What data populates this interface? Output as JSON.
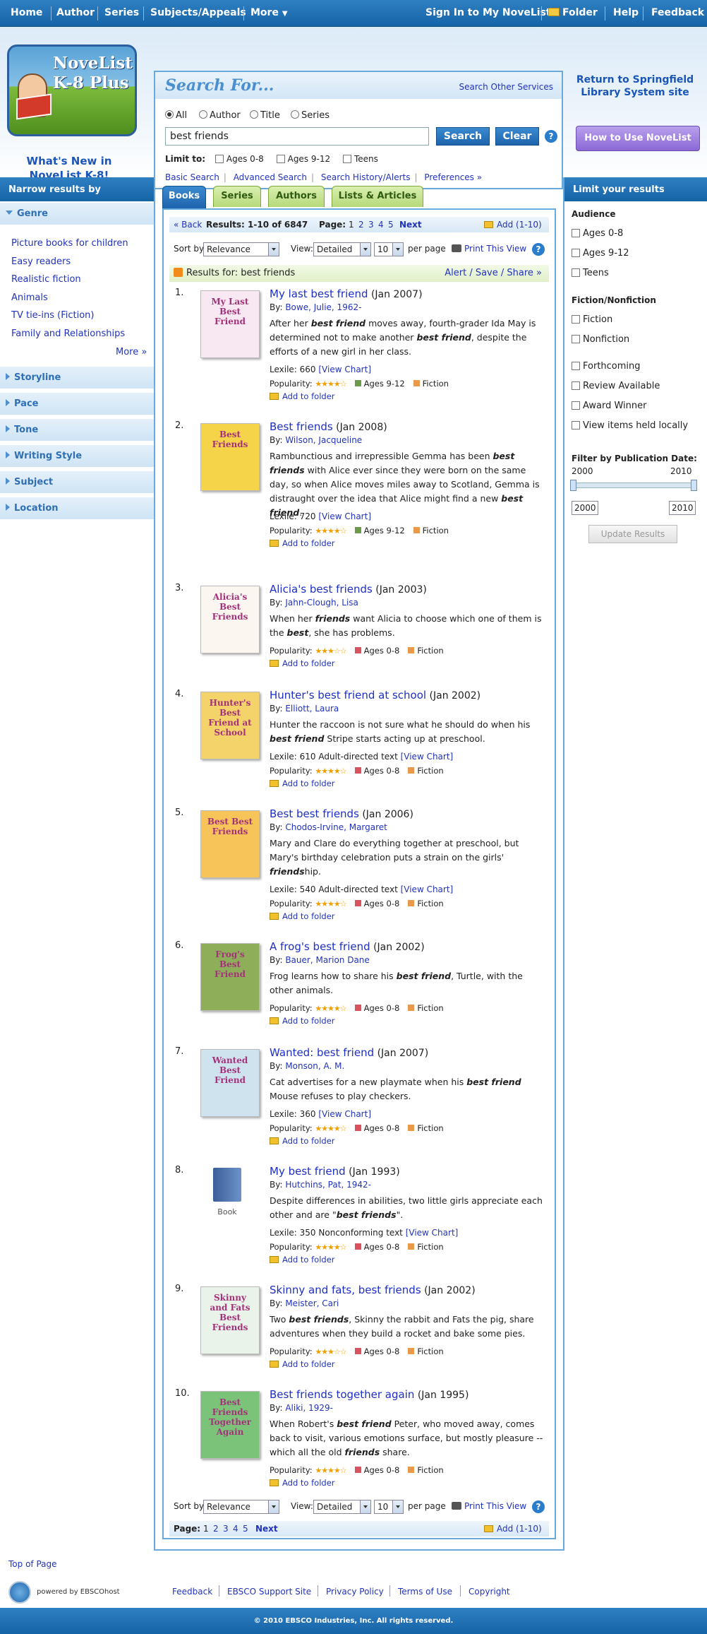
{
  "topnav": {
    "left": [
      "Home",
      "Author",
      "Series",
      "Subjects/Appeals",
      "More"
    ],
    "right": [
      "Sign In to My NoveList",
      "Folder",
      "Help",
      "Feedback"
    ]
  },
  "header": {
    "logo_line1": "NoveList",
    "logo_line2": "K-8 Plus",
    "whats_new": "What's New in NoveList K-8!",
    "search_title": "Search For...",
    "search_other": "Search Other Services",
    "radios": [
      "All",
      "Author",
      "Title",
      "Series"
    ],
    "query": "best friends",
    "search_btn": "Search",
    "clear_btn": "Clear",
    "limit_label": "Limit to:",
    "limits": [
      "Ages 0-8",
      "Ages 9-12",
      "Teens"
    ],
    "links": [
      "Basic Search",
      "Advanced Search",
      "Search History/Alerts",
      "Preferences »"
    ],
    "return": "Return to Springfield Library System site",
    "howto": "How to Use NoveList"
  },
  "left": {
    "narrow": "Narrow results by",
    "genre": "Genre",
    "genres": [
      "Picture books for children",
      "Easy readers",
      "Realistic fiction",
      "Animals",
      "TV tie-ins (Fiction)",
      "Family and Relationships"
    ],
    "more": "More »",
    "facets": [
      "Storyline",
      "Pace",
      "Tone",
      "Writing Style",
      "Subject",
      "Location"
    ]
  },
  "right": {
    "head": "Limit your results",
    "audience": "Audience",
    "aud": [
      "Ages 0-8",
      "Ages 9-12",
      "Teens"
    ],
    "fiction_head": "Fiction/Nonfiction",
    "fic": [
      "Fiction",
      "Nonfiction"
    ],
    "other": [
      "Forthcoming",
      "Review Available",
      "Award Winner",
      "View items held locally"
    ],
    "filter": "Filter by Publication Date:",
    "from": "2000",
    "to": "2010",
    "update": "Update Results"
  },
  "tabs": [
    "Books",
    "Series",
    "Authors",
    "Lists & Articles"
  ],
  "pager": {
    "back": "« Back",
    "results": "Results: 1-10 of 6847",
    "page": "Page:",
    "pages": [
      "1",
      "2",
      "3",
      "4",
      "5"
    ],
    "next": "Next",
    "add": "Add (1-10)"
  },
  "controls": {
    "sortby": "Sort by:",
    "sort": "Relevance",
    "view": "View:",
    "viewval": "Detailed",
    "per": "10",
    "perpage": "per page",
    "print": "Print This View"
  },
  "results_for": "Results for: best friends",
  "alert": "Alert / Save / Share »",
  "items": [
    {
      "n": "1.",
      "title": "My last best friend",
      "date": "(Jan 2007)",
      "by": "Bowe, Julie, 1962-",
      "desc": "After her best friend moves away, fourth-grader Ida May is determined not to make another best friend, despite the efforts of a new girl in her class.",
      "lex": "Lexile: 660",
      "chart": "[View Chart]",
      "stars": 4,
      "age": "Ages 9-12",
      "genre": "Fiction",
      "cover": "My Last Best Friend",
      "cc": "#f7e8f2"
    },
    {
      "n": "2.",
      "title": "Best friends",
      "date": "(Jan 2008)",
      "by": "Wilson, Jacqueline",
      "desc": "Rambunctious and irrepressible Gemma has been best friends with Alice ever since they were born on the same day, so when Alice moves miles away to Scotland, Gemma is distraught over the idea that Alice might find a new best friend.",
      "lex": "Lexile: 720",
      "chart": "[View Chart]",
      "stars": 4,
      "age": "Ages 9-12",
      "genre": "Fiction",
      "cover": "Best Friends",
      "cc": "#f6d44a"
    },
    {
      "n": "3.",
      "title": "Alicia's best friends",
      "date": "(Jan 2003)",
      "by": "Jahn-Clough, Lisa",
      "desc": "When her friends want Alicia to choose which one of them is the best, she has problems.",
      "lex": "",
      "chart": "",
      "stars": 3,
      "age": "Ages 0-8",
      "genre": "Fiction",
      "cover": "Alicia's Best Friends",
      "cc": "#fbf6f0"
    },
    {
      "n": "4.",
      "title": "Hunter's best friend at school",
      "date": "(Jan 2002)",
      "by": "Elliott, Laura",
      "desc": "Hunter the raccoon is not sure what he should do when his best friend Stripe starts acting up at preschool.",
      "lex": "Lexile: 610 Adult-directed text",
      "chart": "[View Chart]",
      "stars": 4,
      "age": "Ages 0-8",
      "genre": "Fiction",
      "cover": "Hunter's Best Friend at School",
      "cc": "#f4d36a"
    },
    {
      "n": "5.",
      "title": "Best best friends",
      "date": "(Jan 2006)",
      "by": "Chodos-Irvine, Margaret",
      "desc": "Mary and Clare do everything together at preschool, but Mary's birthday celebration puts a strain on the girls' friendship.",
      "lex": "Lexile: 540 Adult-directed text",
      "chart": "[View Chart]",
      "stars": 4,
      "age": "Ages 0-8",
      "genre": "Fiction",
      "cover": "Best Best Friends",
      "cc": "#f7c45a"
    },
    {
      "n": "6.",
      "title": "A frog's best friend",
      "date": "(Jan 2002)",
      "by": "Bauer, Marion Dane",
      "desc": "Frog learns how to share his best friend, Turtle, with the other animals.",
      "lex": "",
      "chart": "",
      "stars": 4,
      "age": "Ages 0-8",
      "genre": "Fiction",
      "cover": "Frog's Best Friend",
      "cc": "#8fae5a"
    },
    {
      "n": "7.",
      "title": "Wanted: best friend",
      "date": "(Jan 2007)",
      "by": "Monson, A. M.",
      "desc": "Cat advertises for a new playmate when his best friend Mouse refuses to play checkers.",
      "lex": "Lexile: 360",
      "chart": "[View Chart]",
      "stars": 4,
      "age": "Ages 0-8",
      "genre": "Fiction",
      "cover": "Wanted Best Friend",
      "cc": "#cfe3ef"
    },
    {
      "n": "8.",
      "title": "My best friend",
      "date": "(Jan 1993)",
      "by": "Hutchins, Pat, 1942-",
      "desc": "Despite differences in abilities, two little girls appreciate each other and are \"best friends\".",
      "lex": "Lexile: 350 Nonconforming text",
      "chart": "[View Chart]",
      "stars": 4,
      "age": "Ages 0-8",
      "genre": "Fiction",
      "cover": "Book",
      "cc": "#ffffff"
    },
    {
      "n": "9.",
      "title": "Skinny and fats, best friends",
      "date": "(Jan 2002)",
      "by": "Meister, Cari",
      "desc": "Two best friends, Skinny the rabbit and Fats the pig, share adventures when they build a rocket and bake some pies.",
      "lex": "",
      "chart": "",
      "stars": 3,
      "age": "Ages 0-8",
      "genre": "Fiction",
      "cover": "Skinny and Fats Best Friends",
      "cc": "#e9f3ea"
    },
    {
      "n": "10.",
      "title": "Best friends together again",
      "date": "(Jan 1995)",
      "by": "Aliki, 1929-",
      "desc": "When Robert's best friend Peter, who moved away, comes back to visit, various emotions surface, but mostly pleasure --which all the old friends share.",
      "lex": "",
      "chart": "",
      "stars": 4,
      "age": "Ages 0-8",
      "genre": "Fiction",
      "cover": "Best Friends Together Again",
      "cc": "#7cc37a"
    }
  ],
  "add_to_folder": "Add to folder",
  "popularity": "Popularity:",
  "footer": {
    "top": "Top of Page",
    "powered": "powered by EBSCOhost",
    "links": [
      "Feedback",
      "EBSCO Support Site",
      "Privacy Policy",
      "Terms of Use",
      "Copyright"
    ],
    "copy": "© 2010 EBSCO Industries, Inc. All rights reserved."
  }
}
